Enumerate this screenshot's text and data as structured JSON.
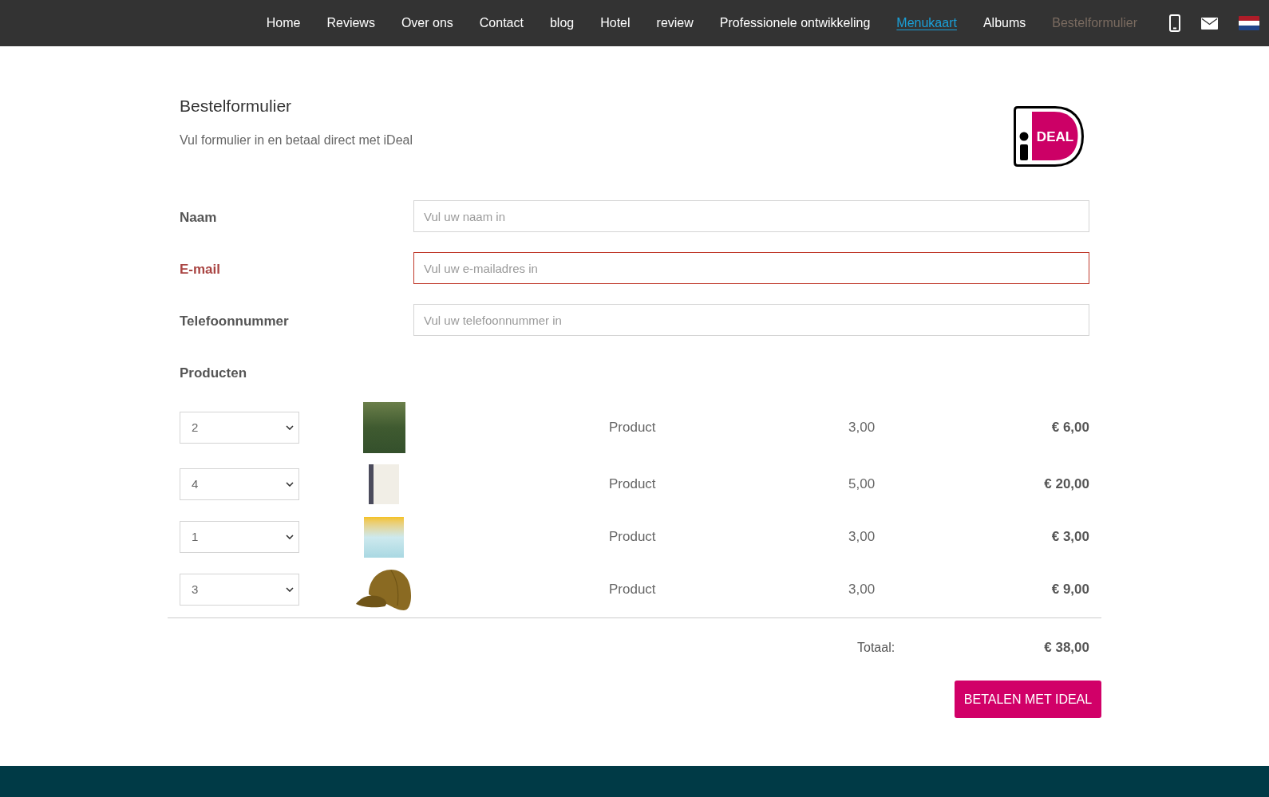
{
  "nav": {
    "items": [
      {
        "label": "Home",
        "selected": false,
        "hovered": false
      },
      {
        "label": "Reviews",
        "selected": false,
        "hovered": false
      },
      {
        "label": "Over ons",
        "selected": false,
        "hovered": false
      },
      {
        "label": "Contact",
        "selected": false,
        "hovered": false
      },
      {
        "label": "blog",
        "selected": false,
        "hovered": false
      },
      {
        "label": "Hotel",
        "selected": false,
        "hovered": false
      },
      {
        "label": "review",
        "selected": false,
        "hovered": false
      },
      {
        "label": "Professionele ontwikkeling",
        "selected": false,
        "hovered": false
      },
      {
        "label": "Menukaart",
        "selected": false,
        "hovered": true
      },
      {
        "label": "Albums",
        "selected": false,
        "hovered": false
      },
      {
        "label": "Bestelformulier",
        "selected": true,
        "hovered": false
      }
    ]
  },
  "header": {
    "title": "Bestelformulier",
    "subtitle": "Vul formulier in en betaal direct met iDeal",
    "logo_text": "DEAL"
  },
  "form": {
    "fields": [
      {
        "label": "Naam",
        "placeholder": "Vul uw naam in",
        "invalid": false
      },
      {
        "label": "E-mail",
        "placeholder": "Vul uw e-mailadres in",
        "invalid": true
      },
      {
        "label": "Telefoonnummer",
        "placeholder": "Vul uw telefoonnummer in",
        "invalid": false
      }
    ]
  },
  "products": {
    "label": "Producten",
    "rows": [
      {
        "quantity": "2",
        "kind": "magazine",
        "name": "Product",
        "price": "3,00",
        "total": "€ 6,00"
      },
      {
        "quantity": "4",
        "kind": "book",
        "name": "Product",
        "price": "5,00",
        "total": "€ 20,00"
      },
      {
        "quantity": "1",
        "kind": "box",
        "name": "Product",
        "price": "3,00",
        "total": "€ 3,00"
      },
      {
        "quantity": "3",
        "kind": "cap",
        "name": "Product",
        "price": "3,00",
        "total": "€ 9,00"
      }
    ]
  },
  "total": {
    "label": "Totaal:",
    "amount": "€ 38,00"
  },
  "button": {
    "label": "BETALEN MET IDEAL"
  }
}
